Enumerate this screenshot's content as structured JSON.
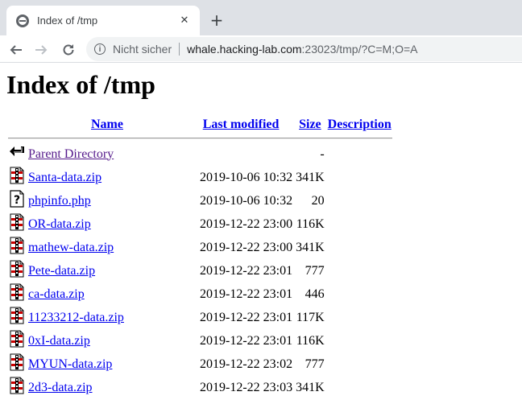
{
  "browser": {
    "tab_title": "Index of /tmp",
    "close_glyph": "✕",
    "new_tab_glyph": "+",
    "security_label": "Nicht sicher",
    "url_host": "whale.hacking-lab.com",
    "url_rest": ":23023/tmp/?C=M;O=A"
  },
  "page": {
    "heading": "Index of /tmp",
    "columns": {
      "name": "Name",
      "last_modified": "Last modified",
      "size": "Size",
      "description": "Description"
    },
    "parent": {
      "label": "Parent Directory",
      "size": "-",
      "icon": "back-arrow-icon"
    },
    "files": [
      {
        "name": "Santa-data.zip",
        "modified": "2019-10-06 10:32",
        "size": "341K",
        "icon": "compressed-file-icon"
      },
      {
        "name": "phpinfo.php",
        "modified": "2019-10-06 10:32",
        "size": "20",
        "icon": "unknown-file-icon"
      },
      {
        "name": "OR-data.zip",
        "modified": "2019-12-22 23:00",
        "size": "116K",
        "icon": "compressed-file-icon"
      },
      {
        "name": "mathew-data.zip",
        "modified": "2019-12-22 23:00",
        "size": "341K",
        "icon": "compressed-file-icon"
      },
      {
        "name": "Pete-data.zip",
        "modified": "2019-12-22 23:01",
        "size": "777",
        "icon": "compressed-file-icon"
      },
      {
        "name": "ca-data.zip",
        "modified": "2019-12-22 23:01",
        "size": "446",
        "icon": "compressed-file-icon"
      },
      {
        "name": "11233212-data.zip",
        "modified": "2019-12-22 23:01",
        "size": "117K",
        "icon": "compressed-file-icon"
      },
      {
        "name": "0xI-data.zip",
        "modified": "2019-12-22 23:01",
        "size": "116K",
        "icon": "compressed-file-icon"
      },
      {
        "name": "MYUN-data.zip",
        "modified": "2019-12-22 23:02",
        "size": "777",
        "icon": "compressed-file-icon"
      },
      {
        "name": "2d3-data.zip",
        "modified": "2019-12-22 23:03",
        "size": "341K",
        "icon": "compressed-file-icon"
      }
    ]
  }
}
